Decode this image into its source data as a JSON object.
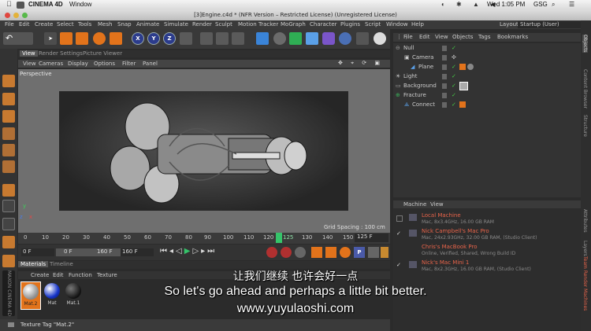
{
  "mac_menubar": {
    "app": "CINEMA 4D",
    "window": "Window",
    "clock": "Wed 1:05 PM",
    "user": "GSG"
  },
  "titlebar": {
    "title": "[3]Engine.c4d * (NFR Version – Restricted License) (Unregistered License)"
  },
  "menubar": [
    "File",
    "Edit",
    "Create",
    "Select",
    "Tools",
    "Mesh",
    "Snap",
    "Animate",
    "Simulate",
    "Render",
    "Sculpt",
    "Motion Tracker",
    "MoGraph",
    "Character",
    "Plugins",
    "Script",
    "Window",
    "Help"
  ],
  "layout": {
    "label": "Layout:",
    "value": "Startup (User)"
  },
  "toolbar": {
    "axes": [
      "X",
      "Y",
      "Z"
    ]
  },
  "viewport": {
    "tabs": [
      "View",
      "Render Settings",
      "Picture Viewer"
    ],
    "menu": [
      "View",
      "Cameras",
      "Display",
      "Options",
      "Filter",
      "Panel"
    ],
    "label": "Perspective",
    "grid_spacing": "Grid Spacing : 100 cm"
  },
  "timeline": {
    "ticks": [
      "0",
      "10",
      "20",
      "30",
      "40",
      "50",
      "60",
      "70",
      "80",
      "90",
      "100",
      "110",
      "120",
      "125",
      "130",
      "140",
      "150",
      "160"
    ],
    "end_frame": "125 F"
  },
  "transport": {
    "start": "0 F",
    "min": "0 F",
    "max": "160 F",
    "end": "160 F"
  },
  "materials": {
    "tabs": [
      "Materials",
      "Timeline"
    ],
    "menu": [
      "Create",
      "Edit",
      "Function",
      "Texture"
    ],
    "items": [
      "Mat.2",
      "Mat",
      "Mat.1"
    ]
  },
  "statusbar": {
    "text": "Texture Tag \"Mat.2\""
  },
  "object_manager": {
    "menu": [
      "File",
      "Edit",
      "View",
      "Objects",
      "Tags",
      "Bookmarks"
    ],
    "objects": [
      "Null",
      "Camera",
      "Plane",
      "Light",
      "Background",
      "Fracture",
      "Connect"
    ]
  },
  "team_render": {
    "menu": [
      "Machine",
      "View"
    ],
    "machines": [
      {
        "name": "Local Machine",
        "info": "Mac, 8x3.4GHz, 16.00 GB RAM"
      },
      {
        "name": "Nick Campbell's Mac Pro",
        "info": "Mac, 24x2.93GHz, 32.00 GB RAM, (Studio Client)"
      },
      {
        "name": "Chris's MacBook Pro",
        "info": "Online, Verified, Shared, Wrong Build ID"
      },
      {
        "name": "Nick's Mac Mini 1",
        "info": "Mac, 8x2.3GHz, 16.00 GB RAM, (Studio Client)"
      }
    ]
  },
  "right_tabs": [
    "Objects",
    "Content Browser",
    "Structure",
    "Attributes",
    "Layers",
    "Team Render Machines"
  ],
  "subtitles": {
    "chinese": "让我们继续  也许会好一点",
    "english": "So let's go ahead and perhaps a little bit better.",
    "url": "www.yuyulaoshi.com"
  },
  "colors": {
    "accent_orange": "#e2731b",
    "timeline_green": "#35c46a",
    "machine_red": "#e8644a"
  }
}
